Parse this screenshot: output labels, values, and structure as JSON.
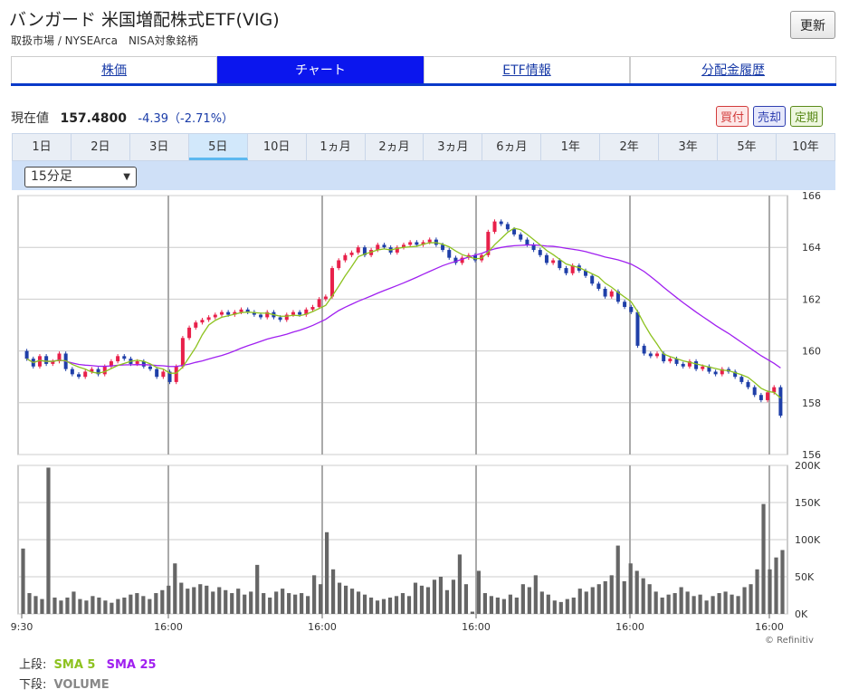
{
  "header": {
    "title": "バンガード 米国増配株式ETF(VIG)",
    "subtitle": "取扱市場 / NYSEArca　NISA対象銘柄",
    "refresh_label": "更新"
  },
  "tabs": [
    {
      "label": "株価",
      "active": false
    },
    {
      "label": "チャート",
      "active": true
    },
    {
      "label": "ETF情報",
      "active": false
    },
    {
      "label": "分配金履歴",
      "active": false
    }
  ],
  "quote": {
    "label": "現在値",
    "price": "157.4800",
    "change": "-4.39（-2.71%）"
  },
  "order_buttons": [
    {
      "label": "買付",
      "color": "#d23b3b",
      "bg": "#fde7e7"
    },
    {
      "label": "売却",
      "color": "#2f3fb0",
      "bg": "#e6e8fb"
    },
    {
      "label": "定期",
      "color": "#5a8a1a",
      "bg": "#eef7df"
    }
  ],
  "ranges": [
    {
      "label": "1日",
      "active": false
    },
    {
      "label": "2日",
      "active": false
    },
    {
      "label": "3日",
      "active": false
    },
    {
      "label": "5日",
      "active": true
    },
    {
      "label": "10日",
      "active": false
    },
    {
      "label": "1ヵ月",
      "active": false
    },
    {
      "label": "2ヵ月",
      "active": false
    },
    {
      "label": "3ヵ月",
      "active": false
    },
    {
      "label": "6ヵ月",
      "active": false
    },
    {
      "label": "1年",
      "active": false
    },
    {
      "label": "2年",
      "active": false
    },
    {
      "label": "3年",
      "active": false
    },
    {
      "label": "5年",
      "active": false
    },
    {
      "label": "10年",
      "active": false
    }
  ],
  "interval_select": {
    "value": "15分足"
  },
  "legend": {
    "upper_label": "上段:",
    "sma5": "SMA 5",
    "sma25": "SMA 25",
    "lower_label": "下段:",
    "volume": "VOLUME",
    "sma5_color": "#8dc21f",
    "sma25_color": "#a020f0"
  },
  "credit": "© Refinitiv",
  "chart_data": [
    {
      "type": "candlestick",
      "ylim": [
        156,
        166
      ],
      "yticks": [
        156,
        158,
        160,
        162,
        164,
        166
      ],
      "x_tick_labels": [
        "9:30",
        "16:00",
        "16:00",
        "16:00",
        "16:00",
        "16:00"
      ],
      "up_color": "#e8204a",
      "down_color": "#1f3fa8",
      "sessions": [
        {
          "closes": [
            159.7,
            159.4,
            159.8,
            159.5,
            159.6,
            159.9,
            159.3,
            159.1,
            159.0,
            159.2,
            159.3,
            159.1,
            159.4,
            159.6,
            159.8,
            159.7,
            159.5,
            159.6,
            159.4,
            159.3,
            159.0,
            159.2,
            158.8
          ]
        },
        {
          "closes": [
            159.4,
            160.5,
            160.9,
            161.1,
            161.2,
            161.3,
            161.4,
            161.5,
            161.4,
            161.5,
            161.6,
            161.5,
            161.4,
            161.3,
            161.5,
            161.3,
            161.2,
            161.4,
            161.5,
            161.4,
            161.6,
            161.7,
            162.0,
            162.1
          ]
        },
        {
          "closes": [
            163.2,
            163.5,
            163.7,
            163.8,
            164.0,
            163.7,
            163.9,
            164.1,
            164.0,
            163.8,
            164.0,
            164.1,
            164.2,
            164.1,
            164.2,
            164.3,
            164.1,
            163.9,
            163.6,
            163.4,
            163.6,
            163.7,
            163.5,
            163.7
          ]
        },
        {
          "closes": [
            164.6,
            165.0,
            164.9,
            164.7,
            164.5,
            164.3,
            164.1,
            163.9,
            163.7,
            163.4,
            163.5,
            163.2,
            163.0,
            163.3,
            163.1,
            162.9,
            162.6,
            162.4,
            162.1,
            162.3,
            161.9,
            161.7,
            161.5
          ]
        },
        {
          "closes": [
            160.2,
            159.9,
            159.8,
            159.9,
            159.6,
            159.7,
            159.5,
            159.4,
            159.6,
            159.3,
            159.4,
            159.2,
            159.1,
            159.3,
            159.2,
            159.0,
            158.8,
            158.6,
            158.3,
            158.1,
            158.4,
            158.6,
            157.5
          ]
        }
      ],
      "sma5": "SMA 5",
      "sma25": "SMA 25"
    },
    {
      "type": "bar",
      "ylim": [
        0,
        200000
      ],
      "yticks": [
        "0K",
        "50K",
        "100K",
        "150K",
        "200K"
      ],
      "ylabel": "VOLUME",
      "values": [
        88000,
        28000,
        24000,
        20000,
        197000,
        22000,
        18000,
        22000,
        30000,
        20000,
        18000,
        24000,
        22000,
        18000,
        15000,
        20000,
        22000,
        26000,
        28000,
        24000,
        20000,
        28000,
        32000,
        38000,
        68000,
        42000,
        34000,
        36000,
        40000,
        38000,
        30000,
        36000,
        32000,
        28000,
        34000,
        26000,
        30000,
        66000,
        28000,
        22000,
        30000,
        34000,
        28000,
        26000,
        28000,
        24000,
        52000,
        40000,
        110000,
        60000,
        42000,
        38000,
        34000,
        30000,
        26000,
        22000,
        18000,
        20000,
        22000,
        24000,
        28000,
        24000,
        42000,
        38000,
        36000,
        46000,
        50000,
        32000,
        46000,
        80000,
        40000,
        3000,
        58000,
        28000,
        24000,
        22000,
        20000,
        26000,
        22000,
        40000,
        36000,
        52000,
        30000,
        26000,
        18000,
        16000,
        20000,
        22000,
        34000,
        30000,
        36000,
        40000,
        44000,
        52000,
        92000,
        44000,
        68000,
        58000,
        48000,
        40000,
        30000,
        22000,
        26000,
        28000,
        36000,
        30000,
        24000,
        26000,
        18000,
        24000,
        28000,
        30000,
        26000,
        24000,
        36000,
        40000,
        60000,
        148000,
        60000,
        76000,
        86000
      ]
    }
  ]
}
